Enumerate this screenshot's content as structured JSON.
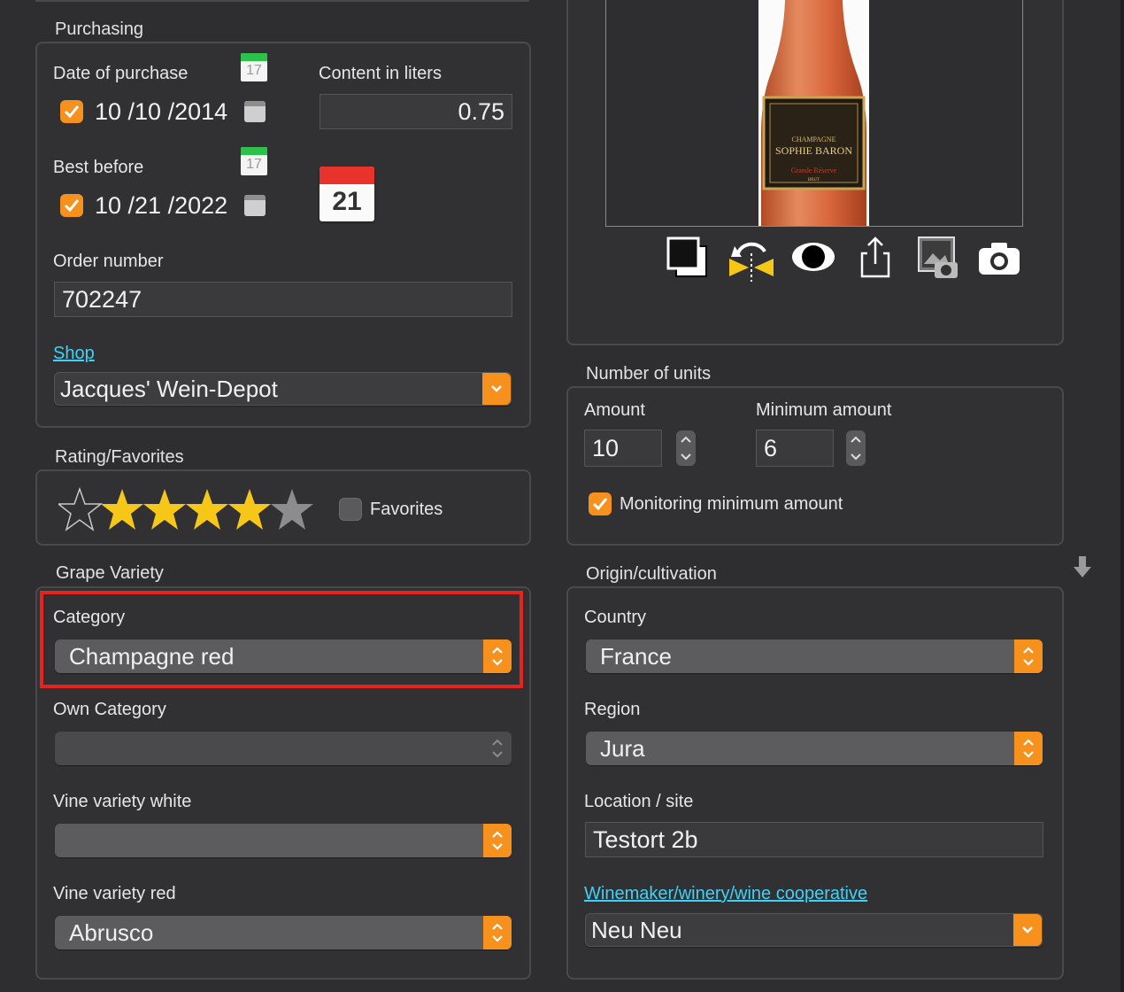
{
  "purchasing": {
    "legend": "Purchasing",
    "date_of_purchase_label": "Date of purchase",
    "date_of_purchase_value": "10 /10 /2014",
    "date_of_purchase_checked": true,
    "calendar_day_small": "17",
    "content_label": "Content in liters",
    "content_value": "0.75",
    "best_before_label": "Best before",
    "best_before_value": "10 /21 /2022",
    "best_before_checked": true,
    "big_calendar_day": "21",
    "order_number_label": "Order number",
    "order_number_value": "702247",
    "shop_link": "Shop",
    "shop_value": "Jacques' Wein-Depot"
  },
  "rating": {
    "legend": "Rating/Favorites",
    "stars_filled": 4,
    "stars_total": 5,
    "favorites_label": "Favorites",
    "favorites_checked": false
  },
  "grape": {
    "legend": "Grape Variety",
    "category_label": "Category",
    "category_value": "Champagne red",
    "own_category_label": "Own Category",
    "own_category_value": "",
    "vine_white_label": "Vine variety white",
    "vine_white_value": "",
    "vine_red_label": "Vine variety red",
    "vine_red_value": "Abrusco"
  },
  "image": {
    "bottle_label_line1": "CHAMPAGNE",
    "bottle_label_line2": "SOPHIE BARON",
    "bottle_label_line3": "Grande Réserve",
    "bottle_label_line4": "BRUT",
    "tools": [
      "copy-icon",
      "flip-icon",
      "eye-icon",
      "share-icon",
      "photo-browser-icon",
      "camera-icon"
    ]
  },
  "units": {
    "legend": "Number of units",
    "amount_label": "Amount",
    "amount_value": "10",
    "minimum_label": "Minimum amount",
    "minimum_value": "6",
    "monitoring_label": "Monitoring minimum amount",
    "monitoring_checked": true
  },
  "origin": {
    "legend": "Origin/cultivation",
    "country_label": "Country",
    "country_value": "France",
    "region_label": "Region",
    "region_value": "Jura",
    "location_label": "Location / site",
    "location_value": "Testort 2b",
    "winemaker_link": "Winemaker/winery/wine cooperative",
    "winemaker_value": "Neu Neu"
  },
  "colors": {
    "accent": "#f7911e",
    "link": "#3fd2f5",
    "highlight": "#e8221c"
  }
}
